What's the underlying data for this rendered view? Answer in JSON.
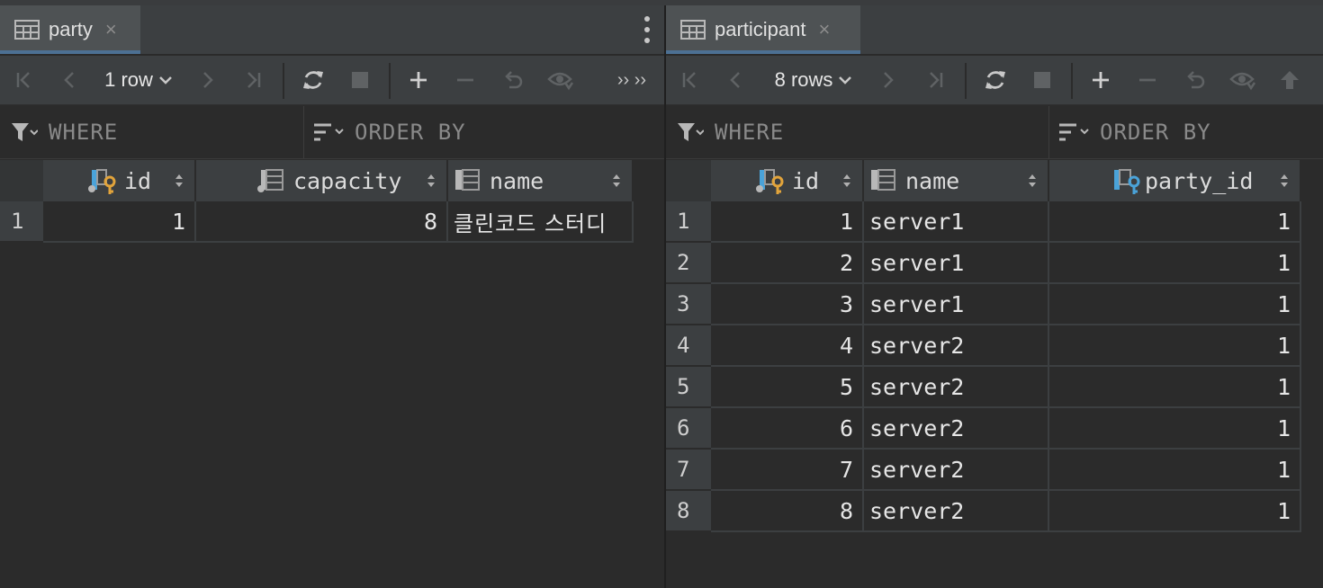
{
  "left": {
    "tab": {
      "label": "party",
      "icon": "table-icon",
      "close": "×"
    },
    "toolbar": {
      "row_count": "1 row",
      "more": "›› ››"
    },
    "filter": {
      "where": "WHERE",
      "order_by": "ORDER BY"
    },
    "columns": [
      {
        "name": "id",
        "icon": "primary-key-column-icon"
      },
      {
        "name": "capacity",
        "icon": "column-icon"
      },
      {
        "name": "name",
        "icon": "column-icon"
      }
    ],
    "rows": [
      {
        "num": "1",
        "cells": [
          "1",
          "8",
          "클린코드 스터디"
        ]
      }
    ]
  },
  "right": {
    "tab": {
      "label": "participant",
      "icon": "table-icon",
      "close": "×"
    },
    "toolbar": {
      "row_count": "8 rows"
    },
    "filter": {
      "where": "WHERE",
      "order_by": "ORDER BY"
    },
    "columns": [
      {
        "name": "id",
        "icon": "primary-key-column-icon"
      },
      {
        "name": "name",
        "icon": "column-icon"
      },
      {
        "name": "party_id",
        "icon": "foreign-key-column-icon"
      }
    ],
    "rows": [
      {
        "num": "1",
        "cells": [
          "1",
          "server1",
          "1"
        ]
      },
      {
        "num": "2",
        "cells": [
          "2",
          "server1",
          "1"
        ]
      },
      {
        "num": "3",
        "cells": [
          "3",
          "server1",
          "1"
        ]
      },
      {
        "num": "4",
        "cells": [
          "4",
          "server2",
          "1"
        ]
      },
      {
        "num": "5",
        "cells": [
          "5",
          "server2",
          "1"
        ]
      },
      {
        "num": "6",
        "cells": [
          "6",
          "server2",
          "1"
        ]
      },
      {
        "num": "7",
        "cells": [
          "7",
          "server2",
          "1"
        ]
      },
      {
        "num": "8",
        "cells": [
          "8",
          "server2",
          "1"
        ]
      }
    ]
  },
  "colors": {
    "accent": "#4a88c7",
    "key": "#e2a43b",
    "fk": "#4aa3d9"
  }
}
